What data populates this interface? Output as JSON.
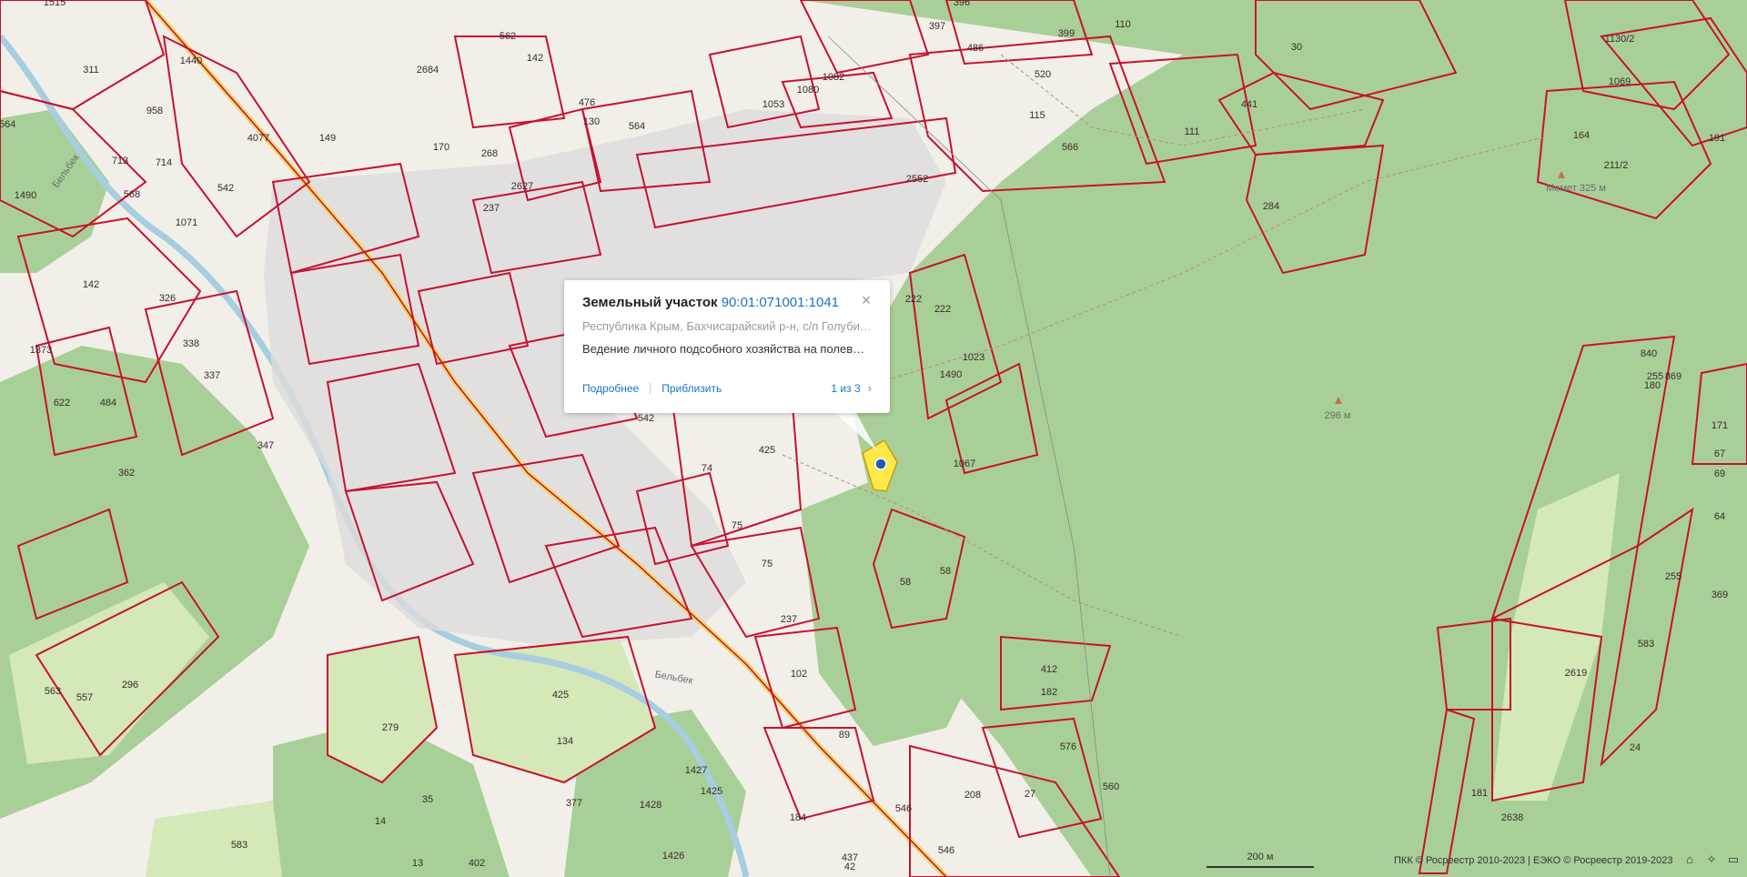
{
  "map": {
    "parcel_labels": [
      "1515",
      "1440",
      "311",
      "958",
      "713",
      "714",
      "542",
      "568",
      "1071",
      "1490",
      "564",
      "4077",
      "149",
      "2684",
      "562",
      "142",
      "130",
      "476",
      "170",
      "268",
      "2627",
      "237",
      "564",
      "1053",
      "1080",
      "1082",
      "2552",
      "1130/2",
      "1069",
      "164",
      "191",
      "211/2",
      "441",
      "111",
      "566",
      "520",
      "115",
      "30",
      "399",
      "397",
      "396",
      "486",
      "110",
      "284",
      "142",
      "326",
      "338",
      "337",
      "347",
      "1373",
      "622",
      "484",
      "362",
      "222",
      "222",
      "1023",
      "1490",
      "542",
      "425",
      "74",
      "75",
      "75",
      "1067",
      "58",
      "58",
      "237",
      "102",
      "89",
      "412",
      "182",
      "576",
      "560",
      "546",
      "208",
      "27",
      "546",
      "437",
      "425",
      "134",
      "377",
      "279",
      "296",
      "557",
      "563",
      "583",
      "402",
      "13",
      "14",
      "35",
      "1428",
      "1427",
      "1425",
      "1426",
      "184",
      "42",
      "840",
      "869",
      "255",
      "255",
      "369",
      "67",
      "171",
      "180",
      "69",
      "64",
      "583",
      "2619",
      "24",
      "2638",
      "181"
    ],
    "place_labels": [
      "Бельбек",
      "Бельбек",
      "296 м",
      "Мемет 325 м"
    ],
    "colors": {
      "background": "#f2efe9",
      "forest": "#a9cf98",
      "field": "#d4e8b8",
      "parcel_border": "#c8102e",
      "parcel_fill": "#f3e4e2",
      "river": "#a6cde0",
      "road": "#f1d56a",
      "selected_parcel": "#ffe84a",
      "settlement": "#dcdcdc"
    }
  },
  "popup": {
    "type_label": "Земельный участок",
    "cadastral_number": "90:01:071001:1041",
    "address": "Республика Крым, Бахчисарайский р-н, с/п Голубин...",
    "usage": "Ведение личного подсобного хозяйства на полевых...",
    "details_link": "Подробнее",
    "zoom_link": "Приблизить",
    "pager": "1 из 3",
    "close_icon": "close-icon",
    "next_icon": "chevron-right-icon"
  },
  "scale": {
    "label": "200 м"
  },
  "attribution": "ПКК © Росреестр 2010-2023 | ЕЭКО © Росреестр 2019-2023",
  "controls": [
    "home-icon",
    "locate-icon",
    "layers-icon"
  ]
}
